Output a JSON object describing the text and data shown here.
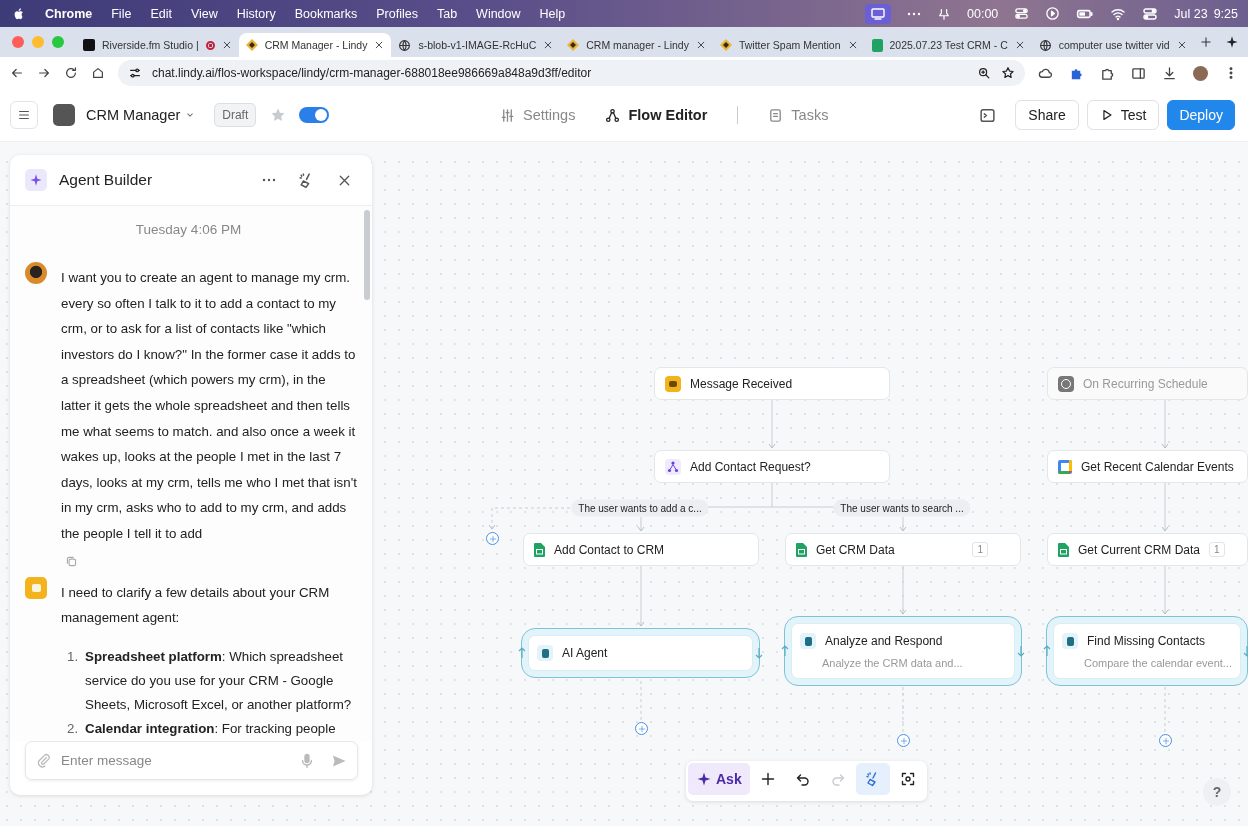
{
  "menubar": {
    "app": "Chrome",
    "menus": [
      "File",
      "Edit",
      "View",
      "History",
      "Bookmarks",
      "Profiles",
      "Tab",
      "Window",
      "Help"
    ],
    "clock": "00:00",
    "date": "Jul 23",
    "time": "9:25"
  },
  "browser": {
    "tabs": [
      {
        "title": "Riverside.fm Studio |",
        "selected": false,
        "recording": true
      },
      {
        "title": "CRM Manager - Lindy",
        "selected": true,
        "recording": false
      },
      {
        "title": "s-blob-v1-IMAGE-RcHuC",
        "selected": false,
        "recording": false
      },
      {
        "title": "CRM manager - Lindy",
        "selected": false,
        "recording": false
      },
      {
        "title": "Twitter Spam Mention",
        "selected": false,
        "recording": false
      },
      {
        "title": "2025.07.23 Test CRM - C",
        "selected": false,
        "recording": false
      },
      {
        "title": "computer use twitter vid",
        "selected": false,
        "recording": false
      }
    ],
    "url": "chat.lindy.ai/flos-workspace/lindy/crm-manager-688018ee986669a848a9d3ff/editor"
  },
  "app_header": {
    "agent_name": "CRM Manager",
    "status": "Draft",
    "starred": false,
    "enabled": true,
    "nav": [
      {
        "label": "Settings",
        "selected": false
      },
      {
        "label": "Flow Editor",
        "selected": true
      },
      {
        "label": "Tasks",
        "selected": false
      }
    ],
    "actions": [
      {
        "label": "Share",
        "kind": "plain"
      },
      {
        "label": "Test",
        "kind": "play"
      },
      {
        "label": "Deploy",
        "kind": "primary"
      }
    ]
  },
  "chat": {
    "title": "Agent Builder",
    "timestamp": "Tuesday 4:06 PM",
    "messages": [
      {
        "kind": "user",
        "text": "I want you to create an agent to manage my crm. every so often I talk to it to add a contact to my crm, or to ask for a list of contacts like \"which investors do I know?\" In the former case it adds to a spreadsheet (which powers my crm), in the latter it gets the whole spreadsheet and then tells me what seems to match. and also once a week it wakes up, looks at the people I met in the last 7 days, looks at my crm, tells me who I met that isn't in my crm, asks who to add to my crm, and adds the people I tell it to add"
      },
      {
        "kind": "agent",
        "text": "I need to clarify a few details about your CRM management agent:",
        "list": [
          {
            "number": "1.",
            "text": "**Spreadsheet platform**: Which spreadsheet service do you use for your CRM - Google Sheets, Microsoft Excel, or another platform?"
          },
          {
            "number": "2.",
            "text": "**Calendar integration**: For tracking people"
          }
        ]
      }
    ],
    "input": {
      "placeholder": "Enter message"
    }
  },
  "flow": {
    "nodes": [
      {
        "kind": "step",
        "label": "Message Received",
        "disabled": false
      },
      {
        "kind": "step",
        "label": "On Recurring Schedule",
        "disabled": true
      },
      {
        "kind": "step",
        "label": "Add Contact Request?",
        "disabled": false
      },
      {
        "kind": "step",
        "label": "Get Recent Calendar Events",
        "disabled": false
      },
      {
        "kind": "step",
        "label": "Add Contact to CRM",
        "disabled": false
      },
      {
        "kind": "step",
        "label": "Get CRM Data",
        "badge": "1",
        "disabled": false
      },
      {
        "kind": "step",
        "label": "Get Current CRM Data",
        "badge": "1",
        "disabled": false
      },
      {
        "kind": "agent",
        "label": "AI Agent",
        "disabled": false
      },
      {
        "kind": "agent",
        "label": "Analyze and Respond",
        "description": "Analyze the CRM data and...",
        "disabled": false
      },
      {
        "kind": "agent",
        "label": "Find Missing Contacts",
        "description": "Compare the calendar event...",
        "disabled": false
      }
    ],
    "branch_labels": [
      "The user wants to add a c...",
      "The user wants to search ..."
    ],
    "tools": [
      {
        "kind": "ask",
        "label": "Ask",
        "selected": false,
        "disabled": false
      },
      {
        "kind": "add",
        "selected": false,
        "disabled": false
      },
      {
        "kind": "undo",
        "selected": false,
        "disabled": false
      },
      {
        "kind": "redo",
        "selected": false,
        "disabled": true
      },
      {
        "kind": "tidy",
        "selected": true,
        "disabled": false
      },
      {
        "kind": "focus",
        "selected": false,
        "disabled": false
      }
    ],
    "help": "?"
  }
}
